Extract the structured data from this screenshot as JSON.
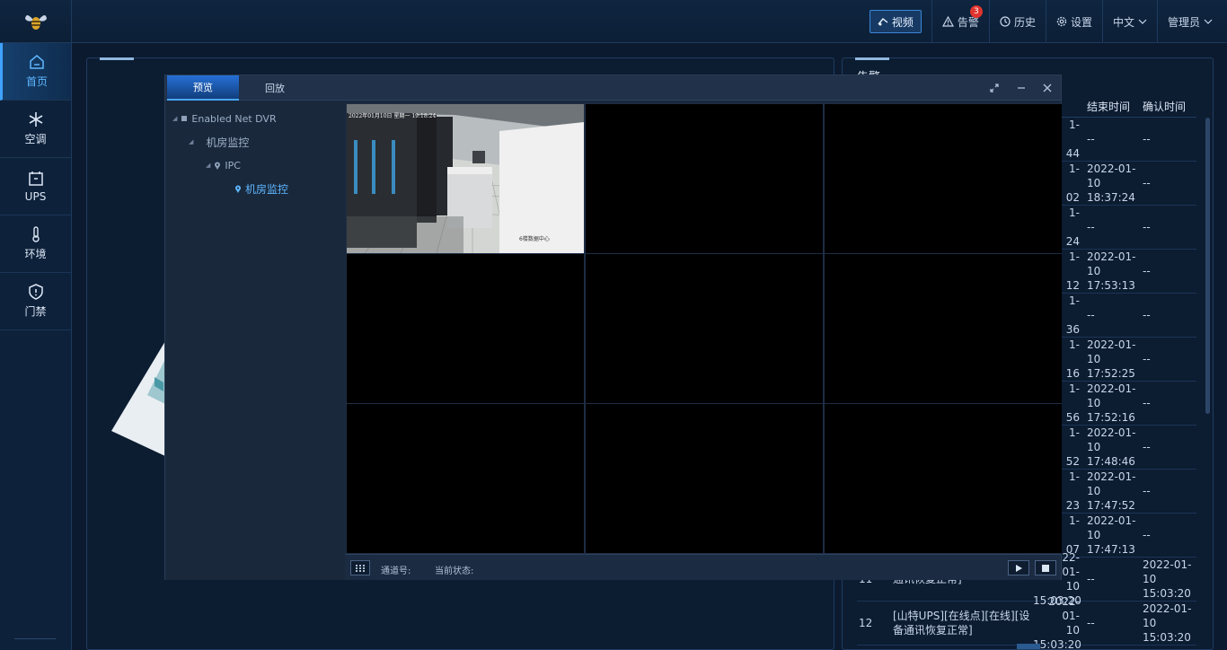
{
  "topbar": {
    "video_label": "视频",
    "alarm_label": "告警",
    "alarm_count": "3",
    "history_label": "历史",
    "settings_label": "设置",
    "language_label": "中文",
    "user_label": "管理员"
  },
  "sidebar": {
    "items": [
      {
        "label": "首页",
        "icon": "home-icon"
      },
      {
        "label": "空调",
        "icon": "snowflake-icon"
      },
      {
        "label": "UPS",
        "icon": "ups-icon"
      },
      {
        "label": "环境",
        "icon": "thermometer-icon"
      },
      {
        "label": "门禁",
        "icon": "shield-icon"
      }
    ]
  },
  "alarm_panel": {
    "title": "告警",
    "columns": [
      "",
      "",
      "间",
      "结束时间",
      "确认时间"
    ],
    "rows": [
      {
        "idx": "",
        "name": "",
        "start": [
          "1-",
          "",
          "44"
        ],
        "end": [
          "--"
        ],
        "ack": "--"
      },
      {
        "idx": "",
        "name": "",
        "start": [
          "1-",
          "",
          "02"
        ],
        "end": [
          "2022-01-",
          "10",
          "18:37:24"
        ],
        "ack": "--"
      },
      {
        "idx": "",
        "name": "",
        "start": [
          "1-",
          "",
          "24"
        ],
        "end": [
          "--"
        ],
        "ack": "--"
      },
      {
        "idx": "",
        "name": "",
        "start": [
          "1-",
          "",
          "12"
        ],
        "end": [
          "2022-01-",
          "10",
          "17:53:13"
        ],
        "ack": "--"
      },
      {
        "idx": "",
        "name": "",
        "start": [
          "1-",
          "",
          "36"
        ],
        "end": [
          "--"
        ],
        "ack": "--"
      },
      {
        "idx": "",
        "name": "",
        "start": [
          "1-",
          "",
          "16"
        ],
        "end": [
          "2022-01-",
          "10",
          "17:52:25"
        ],
        "ack": "--"
      },
      {
        "idx": "",
        "name": "",
        "start": [
          "1-",
          "",
          "56"
        ],
        "end": [
          "2022-01-",
          "10",
          "17:52:16"
        ],
        "ack": "--"
      },
      {
        "idx": "",
        "name": "",
        "start": [
          "1-",
          "",
          "52"
        ],
        "end": [
          "2022-01-",
          "10",
          "17:48:46"
        ],
        "ack": "--"
      },
      {
        "idx": "",
        "name": "",
        "start": [
          "1-",
          "",
          "23"
        ],
        "end": [
          "2022-01-",
          "10",
          "17:47:52"
        ],
        "ack": "--"
      },
      {
        "idx": "",
        "name": "",
        "start": [
          "1-",
          "",
          "07"
        ],
        "end": [
          "2022-01-",
          "10",
          "17:47:13"
        ],
        "ack": "--"
      },
      {
        "idx": "11",
        "name": "通讯恢复正常]",
        "start": [
          "2022-01-",
          "10",
          "15:03:20"
        ],
        "end": [
          "--"
        ],
        "ack": "2022-01-10 15:03:20"
      },
      {
        "idx": "12",
        "name": "[山特UPS][在线点][在线][设备通讯恢复正常]",
        "start": [
          "2022-01-",
          "10",
          "15:03:20"
        ],
        "end": [
          "--"
        ],
        "ack": "2022-01-10 15:03:20"
      }
    ]
  },
  "video_window": {
    "tab_preview": "预览",
    "tab_playback": "回放",
    "tree": {
      "root": "Enabled Net DVR",
      "group": "机房监控",
      "ipc": "IPC",
      "camera": "机房监控"
    },
    "camera_overlay_time": "2022年01月10日 星期一 19:18:24",
    "camera_overlay_label": "6楼数据中心",
    "channel_label": "通道号:",
    "status_label": "当前状态:"
  },
  "colors": {
    "accent": "#3fa2ff",
    "badge": "#e0332e",
    "background": "#0b1a2e"
  }
}
